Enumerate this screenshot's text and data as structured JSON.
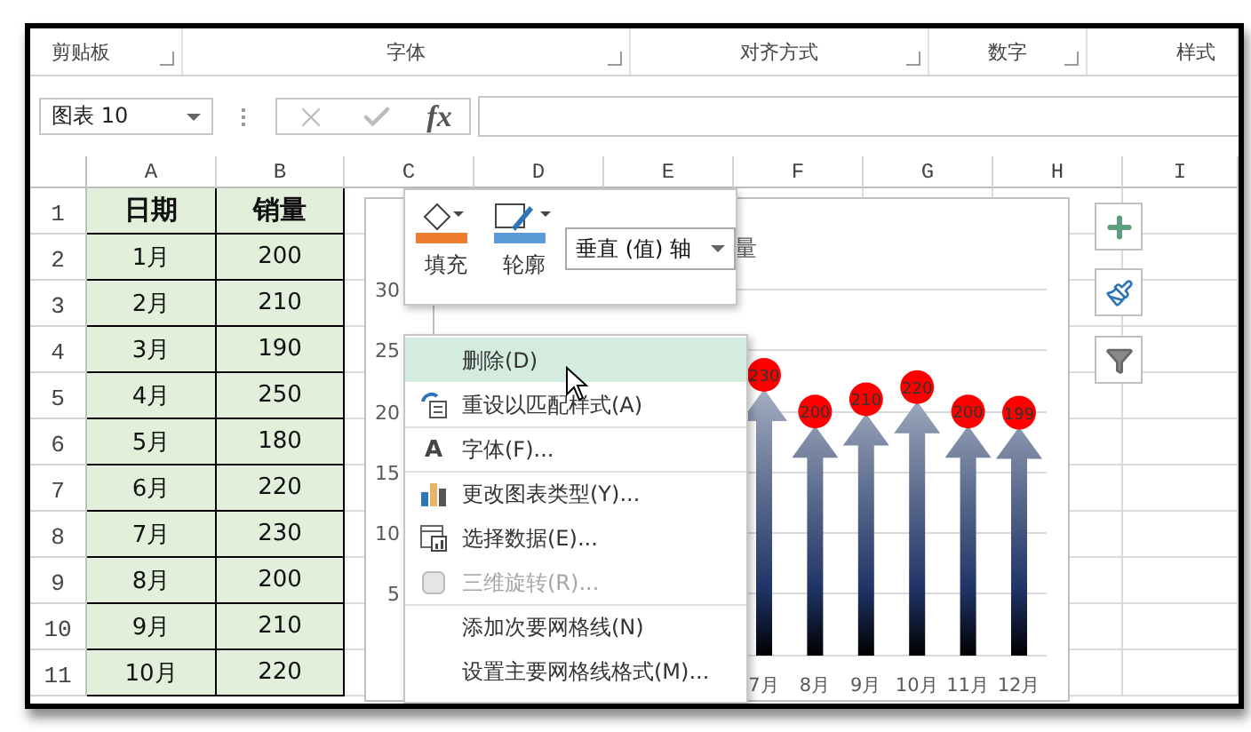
{
  "ribbon_groups": [
    {
      "label": "剪贴板",
      "launcher": true
    },
    {
      "label": "字体",
      "launcher": true
    },
    {
      "label": "对齐方式",
      "launcher": true
    },
    {
      "label": "数字",
      "launcher": true
    },
    {
      "label": "样式",
      "launcher": false
    }
  ],
  "formula_bar": {
    "name_box": "图表 10",
    "function_button": "fx"
  },
  "columns": [
    "A",
    "B",
    "C",
    "D",
    "E",
    "F",
    "G",
    "H",
    "I"
  ],
  "rows": [
    {
      "number": "1",
      "cells": [
        "日期",
        "销量"
      ]
    },
    {
      "number": "2",
      "cells": [
        "1月",
        "200"
      ]
    },
    {
      "number": "3",
      "cells": [
        "2月",
        "210"
      ]
    },
    {
      "number": "4",
      "cells": [
        "3月",
        "190"
      ]
    },
    {
      "number": "5",
      "cells": [
        "4月",
        "250"
      ]
    },
    {
      "number": "6",
      "cells": [
        "5月",
        "180"
      ]
    },
    {
      "number": "7",
      "cells": [
        "6月",
        "220"
      ]
    },
    {
      "number": "8",
      "cells": [
        "7月",
        "230"
      ]
    },
    {
      "number": "9",
      "cells": [
        "8月",
        "200"
      ]
    },
    {
      "number": "10",
      "cells": [
        "9月",
        "210"
      ]
    },
    {
      "number": "11",
      "cells": [
        "10月",
        "220"
      ]
    }
  ],
  "chart": {
    "title": "量",
    "y_axis_labels": [
      "30",
      "25",
      "20",
      "15",
      "10",
      "5"
    ],
    "bars": [
      {
        "category": "7月",
        "value_label": "230"
      },
      {
        "category": "8月",
        "value_label": "200"
      },
      {
        "category": "9月",
        "value_label": "210"
      },
      {
        "category": "10月",
        "value_label": "220"
      },
      {
        "category": "11月",
        "value_label": "200"
      },
      {
        "category": "12月",
        "value_label": "199"
      }
    ]
  },
  "mini_toolbar": {
    "fill_label": "填充",
    "outline_label": "轮廓",
    "element_select": "垂直 (值) 轴"
  },
  "context_menu": {
    "items": [
      {
        "label": "删除(D)",
        "kind": "plain",
        "selected": true,
        "disabled": false,
        "group_start": false
      },
      {
        "label": "重设以匹配样式(A)",
        "kind": "reset",
        "selected": false,
        "disabled": false,
        "group_start": false
      },
      {
        "label": "字体(F)...",
        "kind": "glyph",
        "glyph": "A",
        "selected": false,
        "disabled": false,
        "group_start": true
      },
      {
        "label": "更改图表类型(Y)...",
        "kind": "chart",
        "selected": false,
        "disabled": false,
        "group_start": true
      },
      {
        "label": "选择数据(E)...",
        "kind": "data",
        "selected": false,
        "disabled": false,
        "group_start": false
      },
      {
        "label": "三维旋转(R)...",
        "kind": "cube",
        "selected": false,
        "disabled": true,
        "group_start": false
      },
      {
        "label": "添加次要网格线(N)",
        "kind": "plain",
        "selected": false,
        "disabled": false,
        "group_start": true
      },
      {
        "label": "设置主要网格线格式(M)...",
        "kind": "plain",
        "selected": false,
        "disabled": false,
        "group_start": false
      }
    ]
  }
}
